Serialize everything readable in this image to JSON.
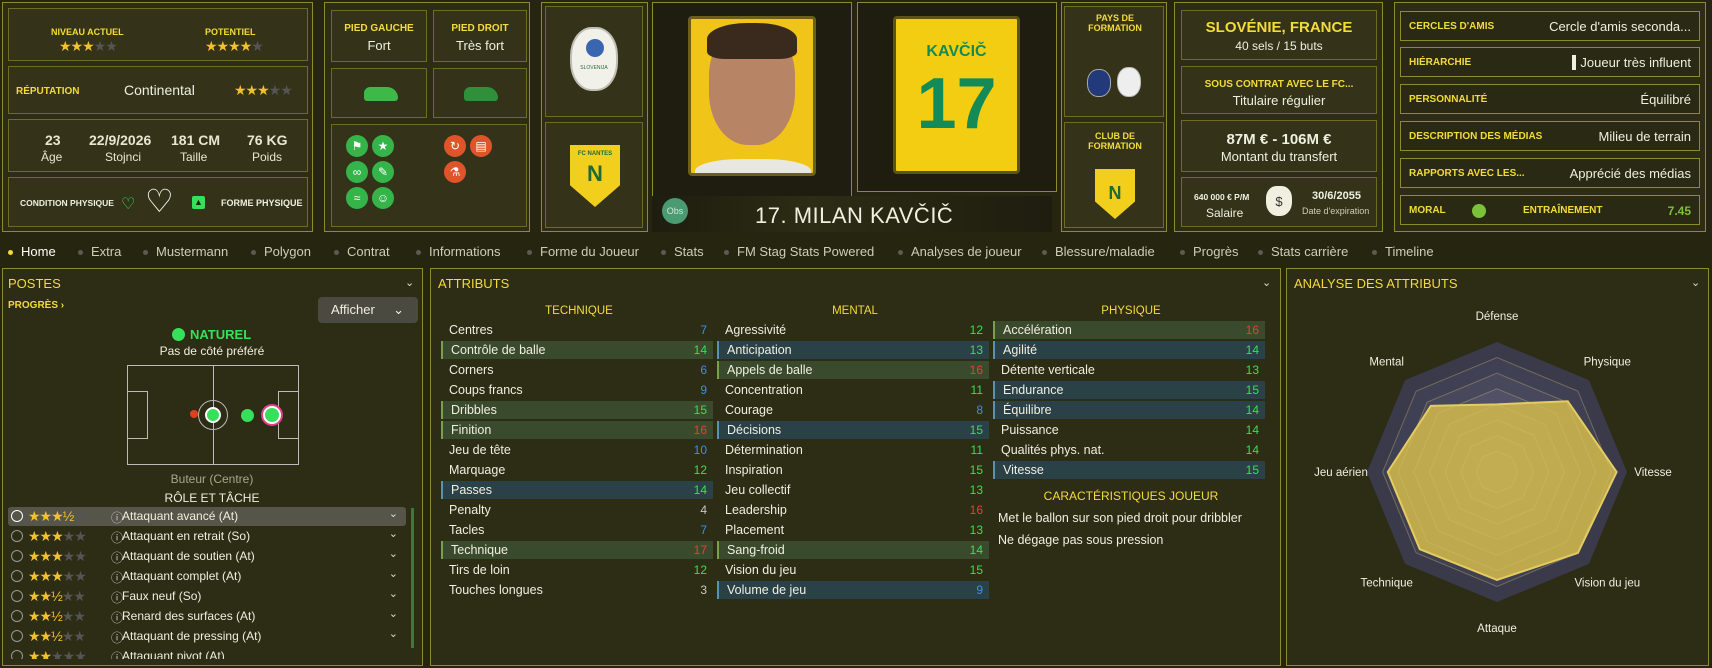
{
  "header": {
    "niveau_label": "NIVEAU ACTUEL",
    "niveau_stars": 3,
    "potentiel_label": "POTENTIEL",
    "potentiel_stars": 4,
    "reputation_label": "RÉPUTATION",
    "reputation_value": "Continental",
    "reputation_stars": 3,
    "age_value": "23",
    "age_label": "Âge",
    "date_value": "22/9/2026",
    "date_label": "Stojnci",
    "taille_value": "181 CM",
    "taille_label": "Taille",
    "poids_value": "76 KG",
    "poids_label": "Poids",
    "condition_label": "CONDITION PHYSIQUE",
    "forme_label": "FORME PHYSIQUE",
    "pied_gauche_label": "PIED GAUCHE",
    "pied_gauche_value": "Fort",
    "pied_droit_label": "PIED DROIT",
    "pied_droit_value": "Très fort",
    "player_title": "17. MILAN KAVČIČ",
    "obs_label": "Obs",
    "shirt_name": "KAVČIČ",
    "shirt_number": "17",
    "pays_formation_label": "PAYS DE FORMATION",
    "club_formation_label": "CLUB DE FORMATION",
    "nationality": "SLOVÉNIE, FRANCE",
    "caps": "40 sels / 15 buts",
    "contrat_label": "SOUS CONTRAT AVEC LE FC...",
    "contrat_value": "Titulaire régulier",
    "valeur": "87M € - 106M €",
    "valeur_label": "Montant du transfert",
    "salaire_value": "640 000 € P/M",
    "salaire_label": "Salaire",
    "expiration_value": "30/6/2055",
    "expiration_label": "Date d'expiration",
    "club_badge_text": "FC NANTES",
    "slovenia_badge_text": "SLOVENIJA"
  },
  "right_panel": [
    {
      "k": "CERCLES D'AMIS",
      "v": "Cercle d'amis seconda..."
    },
    {
      "k": "HIÉRARCHIE",
      "v": "Joueur très influent"
    },
    {
      "k": "PERSONNALITÉ",
      "v": "Équilibré"
    },
    {
      "k": "DESCRIPTION DES MÉDIAS",
      "v": "Milieu de terrain"
    },
    {
      "k": "RAPPORTS AVEC LES...",
      "v": "Apprécié des médias"
    }
  ],
  "moral_label": "MORAL",
  "entrainement_label": "ENTRAÎNEMENT",
  "entrainement_value": "7.45",
  "tabs": [
    "Home",
    "Extra",
    "Mustermann",
    "Polygon",
    "Contrat",
    "Informations",
    "Forme du Joueur",
    "Stats",
    "FM Stag Stats Powered",
    "Analyses de joueur",
    "Blessure/maladie",
    "Progrès",
    "Stats carrière",
    "Timeline"
  ],
  "postes": {
    "title": "POSTES",
    "progres": "PROGRÈS",
    "afficher": "Afficher",
    "naturel": "NATUREL",
    "pied_pref": "Pas de côté préféré",
    "role_position": "Buteur (Centre)",
    "role_tache": "RÔLE ET TÂCHE",
    "roles": [
      {
        "name": "Attaquant avancé (At)",
        "stars": 3.5
      },
      {
        "name": "Attaquant en retrait (So)",
        "stars": 3
      },
      {
        "name": "Attaquant de soutien (At)",
        "stars": 3
      },
      {
        "name": "Attaquant complet (At)",
        "stars": 3
      },
      {
        "name": "Faux neuf (So)",
        "stars": 2.5
      },
      {
        "name": "Renard des surfaces (At)",
        "stars": 2.5
      },
      {
        "name": "Attaquant de pressing (At)",
        "stars": 2.5
      },
      {
        "name": "Attaquant pivot (At)",
        "stars": 2
      }
    ]
  },
  "attributs": {
    "title": "ATTRIBUTS",
    "technique_label": "TECHNIQUE",
    "mental_label": "MENTAL",
    "physique_label": "PHYSIQUE",
    "technique": [
      {
        "n": "Centres",
        "v": "7"
      },
      {
        "n": "Contrôle de balle",
        "v": "14"
      },
      {
        "n": "Corners",
        "v": "6"
      },
      {
        "n": "Coups francs",
        "v": "9"
      },
      {
        "n": "Dribbles",
        "v": "15"
      },
      {
        "n": "Finition",
        "v": "16"
      },
      {
        "n": "Jeu de tête",
        "v": "10"
      },
      {
        "n": "Marquage",
        "v": "12"
      },
      {
        "n": "Passes",
        "v": "14"
      },
      {
        "n": "Penalty",
        "v": "4"
      },
      {
        "n": "Tacles",
        "v": "7"
      },
      {
        "n": "Technique",
        "v": "17"
      },
      {
        "n": "Tirs de loin",
        "v": "12"
      },
      {
        "n": "Touches longues",
        "v": "3"
      }
    ],
    "mental": [
      {
        "n": "Agressivité",
        "v": "12"
      },
      {
        "n": "Anticipation",
        "v": "13"
      },
      {
        "n": "Appels de balle",
        "v": "16"
      },
      {
        "n": "Concentration",
        "v": "11"
      },
      {
        "n": "Courage",
        "v": "8"
      },
      {
        "n": "Décisions",
        "v": "15"
      },
      {
        "n": "Détermination",
        "v": "11"
      },
      {
        "n": "Inspiration",
        "v": "15"
      },
      {
        "n": "Jeu collectif",
        "v": "13"
      },
      {
        "n": "Leadership",
        "v": "16"
      },
      {
        "n": "Placement",
        "v": "13"
      },
      {
        "n": "Sang-froid",
        "v": "14"
      },
      {
        "n": "Vision du jeu",
        "v": "15"
      },
      {
        "n": "Volume de jeu",
        "v": "9"
      }
    ],
    "physique": [
      {
        "n": "Accélération",
        "v": "16"
      },
      {
        "n": "Agilité",
        "v": "14"
      },
      {
        "n": "Détente verticale",
        "v": "13"
      },
      {
        "n": "Endurance",
        "v": "15"
      },
      {
        "n": "Équilibre",
        "v": "14"
      },
      {
        "n": "Puissance",
        "v": "14"
      },
      {
        "n": "Qualités phys. nat.",
        "v": "14"
      },
      {
        "n": "Vitesse",
        "v": "15"
      }
    ],
    "caracteristiques_label": "CARACTÉRISTIQUES JOUEUR",
    "caracteristiques": [
      "Met le ballon sur son pied droit pour dribbler",
      "Ne dégage pas sous pression"
    ]
  },
  "analyse": {
    "title": "ANALYSE DES ATTRIBUTS",
    "labels": [
      "Défense",
      "Physique",
      "Vitesse",
      "Vision du jeu",
      "Attaque",
      "Technique",
      "Jeu aérien",
      "Mental"
    ],
    "values": [
      0.52,
      0.77,
      0.92,
      0.88,
      0.83,
      0.84,
      0.84,
      0.72
    ]
  },
  "colors": {
    "accent": "#f3dc3a",
    "high": "#36e05a",
    "mid_blue": "#3a8ff0",
    "red": "#f03a3a",
    "radar_fill": "#c9b24d"
  }
}
